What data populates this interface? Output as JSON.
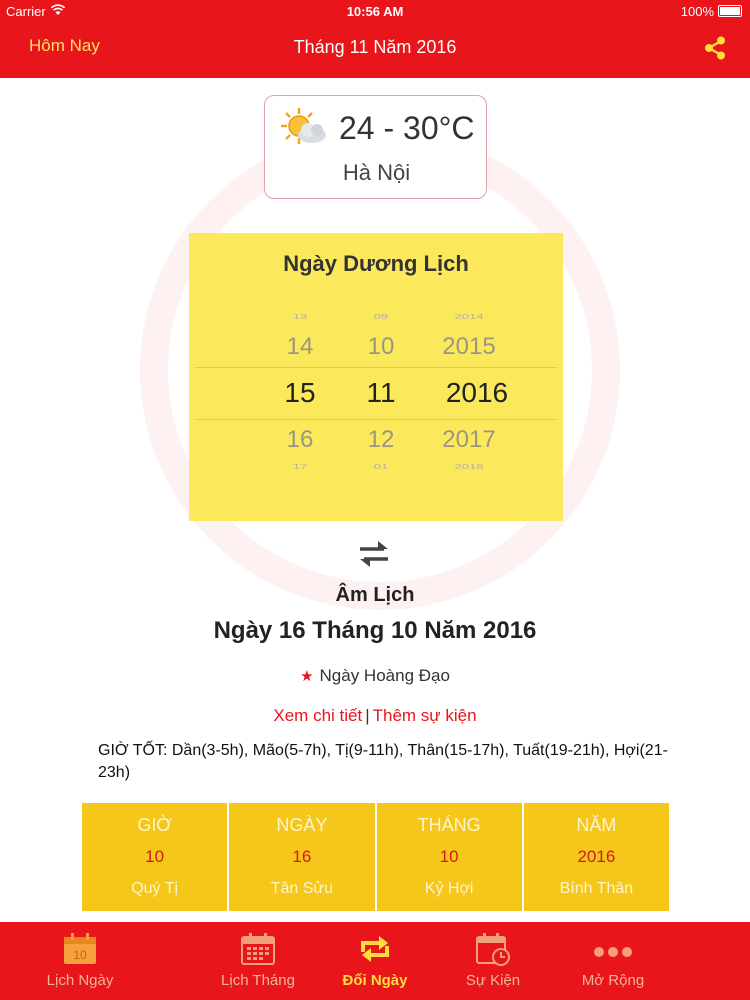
{
  "status": {
    "carrier": "Carrier",
    "time": "10:56 AM",
    "battery": "100%"
  },
  "nav": {
    "today": "Hôm Nay",
    "title": "Tháng 11 Năm 2016"
  },
  "weather": {
    "temp": "24 - 30°C",
    "city": "Hà Nội"
  },
  "picker": {
    "title": "Ngày Dương Lịch",
    "days": [
      "13",
      "14",
      "15",
      "16",
      "17"
    ],
    "months": [
      "09",
      "10",
      "11",
      "12",
      "01"
    ],
    "years": [
      "2014",
      "2015",
      "2016",
      "2017",
      "2018"
    ]
  },
  "lunar": {
    "label": "Âm Lịch",
    "date": "Ngày 16 Tháng 10 Năm 2016",
    "day_type": "Ngày Hoàng Đạo",
    "detail_link": "Xem chi tiết",
    "separator": "|",
    "add_event_link": "Thêm sự kiện",
    "good_hours": "GIỜ TỐT: Dần(3-5h), Mão(5-7h), Tị(9-11h), Thân(15-17h), Tuất(19-21h), Hợi(21-23h)"
  },
  "table": [
    {
      "header": "GIỜ",
      "value": "10",
      "can_chi": "Quý Tị"
    },
    {
      "header": "NGÀY",
      "value": "16",
      "can_chi": "Tân Sửu"
    },
    {
      "header": "THÁNG",
      "value": "10",
      "can_chi": "Kỷ Hợi"
    },
    {
      "header": "NĂM",
      "value": "2016",
      "can_chi": "Bính Thân"
    }
  ],
  "tabs": [
    {
      "label": "Lịch Ngày",
      "icon": "calendar-day-icon",
      "badge": "10"
    },
    {
      "label": "Lịch Tháng",
      "icon": "calendar-month-icon"
    },
    {
      "label": "Đổi Ngày",
      "icon": "convert-date-icon"
    },
    {
      "label": "Sự Kiện",
      "icon": "event-icon"
    },
    {
      "label": "Mở Rộng",
      "icon": "more-icon"
    }
  ],
  "colors": {
    "primary": "#e8151b",
    "accent": "#ffde3a",
    "picker_bg": "#fce85b",
    "table_bg": "#f6c71b"
  }
}
